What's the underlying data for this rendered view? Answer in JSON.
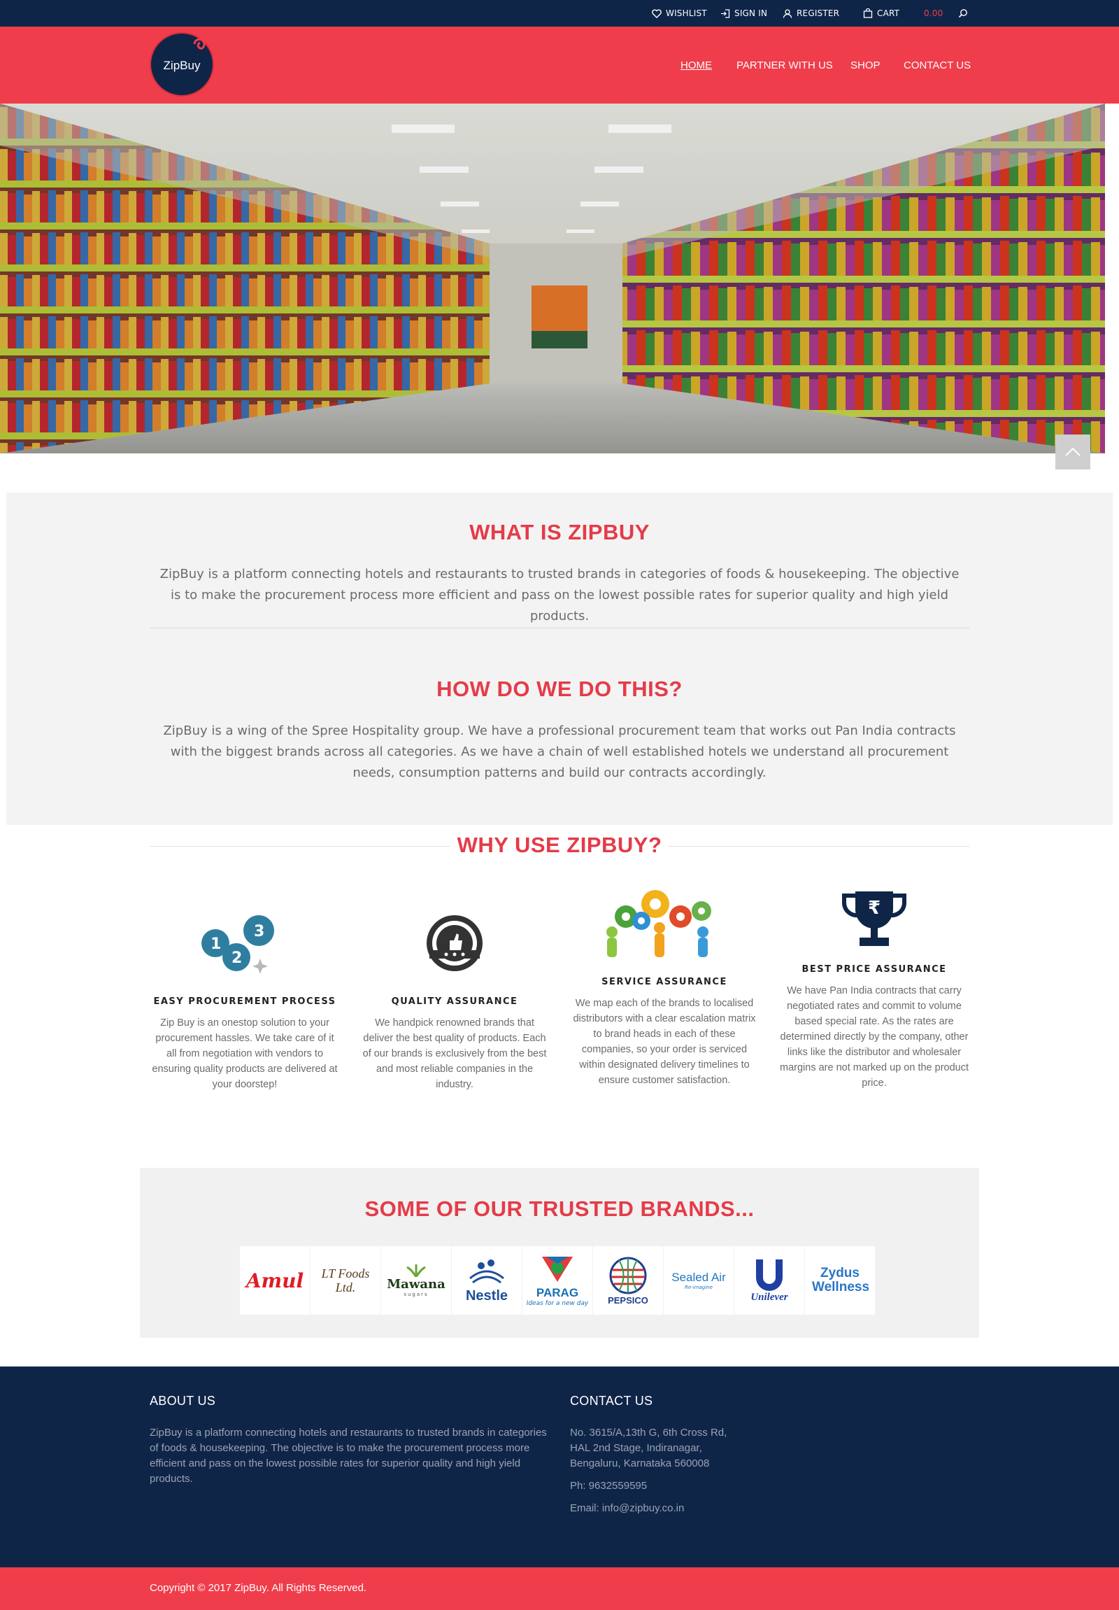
{
  "topbar": {
    "wishlist": "WISHLIST",
    "sign_in": "SIGN IN",
    "register": "REGISTER",
    "cart": "CART",
    "cart_total": "0.00"
  },
  "header": {
    "logo_text": "ZipBuy",
    "nav": [
      "HOME",
      "PARTNER WITH US",
      "SHOP",
      "CONTACT US"
    ]
  },
  "what": {
    "title": "WHAT IS ZIPBUY",
    "text": "ZipBuy is a platform connecting hotels and restaurants to trusted brands in categories of foods & housekeeping. The objective is to make the procurement process more efficient and pass on the lowest possible rates for superior quality and high yield products."
  },
  "how": {
    "title": "HOW DO WE DO THIS?",
    "text": "ZipBuy is a wing of the Spree Hospitality group. We have a professional procurement team that works out Pan India contracts with the biggest brands across all categories. As we have a chain of well established hotels we understand all procurement needs, consumption patterns and build our contracts accordingly."
  },
  "why": {
    "title": "WHY USE ZIPBUY?",
    "features": [
      {
        "icon": "numbered-gears-icon",
        "title": "EASY PROCUREMENT PROCESS",
        "text": "Zip Buy is an onestop solution to your procurement hassles. We take care of it all from negotiation with vendors to ensuring quality products are delivered at your doorstep!"
      },
      {
        "icon": "quality-badge-icon",
        "title": "QUALITY ASSURANCE",
        "text": "We handpick renowned brands that deliver the best quality of products. Each of our brands is exclusively from the best and most reliable companies in the industry."
      },
      {
        "icon": "team-gears-icon",
        "title": "SERVICE ASSURANCE",
        "text": "We map each of the brands to localised distributors with a clear escalation matrix to brand heads in each of these companies, so your order is serviced within designated delivery timelines to ensure customer satisfaction."
      },
      {
        "icon": "rupee-trophy-icon",
        "title": "BEST PRICE ASSURANCE",
        "text": "We have Pan India contracts that carry negotiated rates and commit to volume based special rate. As the rates are determined directly by the company, other links like the distributor and wholesaler margins are not marked up on the product price."
      }
    ]
  },
  "brands": {
    "title": "SOME OF OUR TRUSTED BRANDS...",
    "items": [
      {
        "name": "Amul",
        "color": "#e21b23"
      },
      {
        "name": "LT Foods Ltd.",
        "color": "#5a3b1f"
      },
      {
        "name": "Mawana",
        "sub": "sugars",
        "color": "#1f5a2a"
      },
      {
        "name": "Nestle",
        "color": "#1f4e9a"
      },
      {
        "name": "PARAG",
        "sub": "Ideas for a new day",
        "color": "#1a6fb5"
      },
      {
        "name": "PEPSICO",
        "color": "#1d3f8c"
      },
      {
        "name": "Sealed Air",
        "sub": "Re-imagine",
        "color": "#1f78c2"
      },
      {
        "name": "Unilever",
        "color": "#1f3fa3"
      },
      {
        "name": "Zydus Wellness",
        "color": "#2a75c9"
      }
    ]
  },
  "footer": {
    "about_title": "ABOUT US",
    "about_text": "ZipBuy is a platform connecting hotels and restaurants to trusted brands in categories of foods & housekeeping. The objective is to make the procurement process more efficient and pass on the lowest possible rates for superior quality and high yield products.",
    "contact_title": "CONTACT US",
    "address": [
      "No. 3615/A,13th G, 6th Cross Rd,",
      "HAL 2nd Stage, Indiranagar,",
      "Bengaluru, Karnataka 560008"
    ],
    "phone": "Ph: 9632559595",
    "email": "Email: info@zipbuy.co.in",
    "copyright": "Copyright © 2017 ZipBuy. All Rights Reserved."
  },
  "colors": {
    "brand_red": "#ef3d4b",
    "navy": "#0f2548",
    "title_red": "#e53b48"
  }
}
